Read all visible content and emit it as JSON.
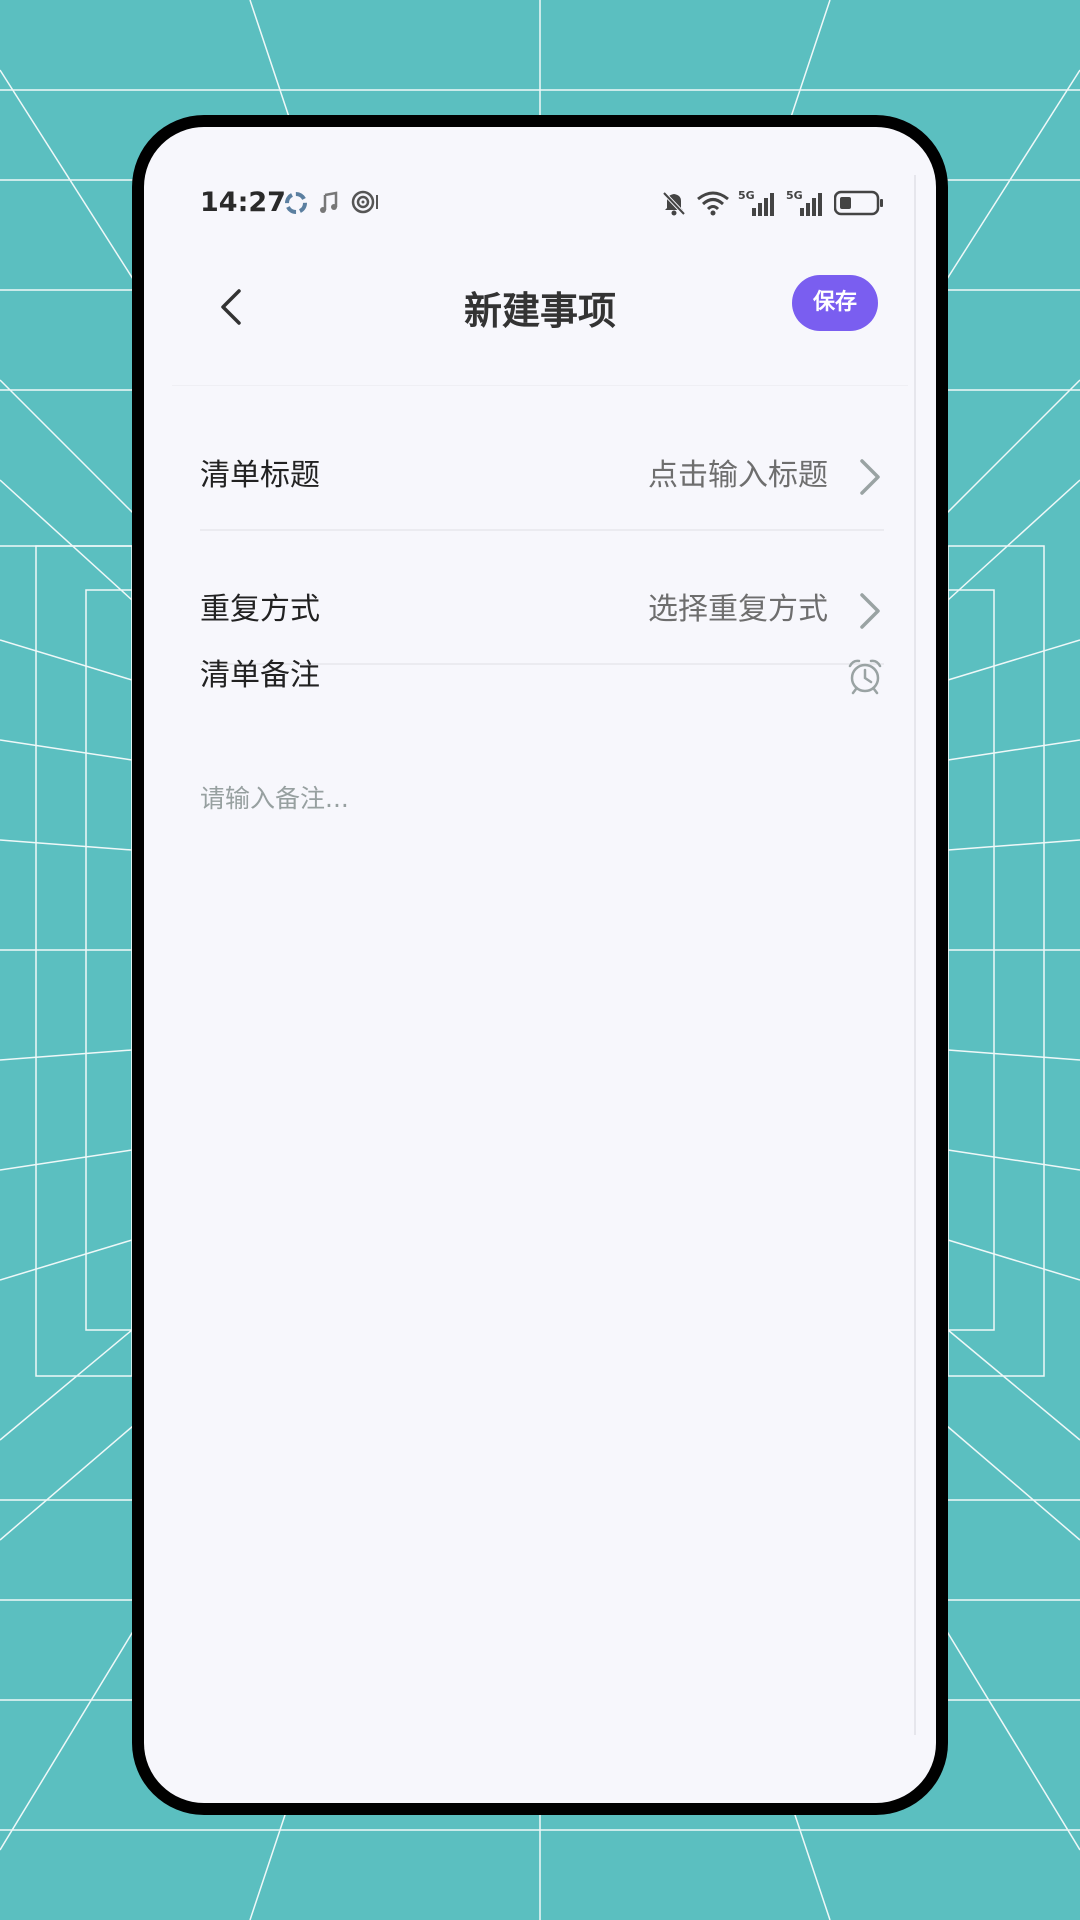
{
  "status_bar": {
    "time": "14:27",
    "network_label": "5G"
  },
  "header": {
    "title": "新建事项",
    "save_label": "保存"
  },
  "form": {
    "title_row": {
      "label": "清单标题",
      "placeholder": "点击输入标题"
    },
    "repeat_row": {
      "label": "重复方式",
      "placeholder": "选择重复方式"
    },
    "notes": {
      "label": "清单备注",
      "placeholder": "请输入备注..."
    }
  },
  "colors": {
    "accent": "#7a5ef0",
    "background": "#5bbfc0",
    "screen": "#f7f7fc"
  },
  "icons": {
    "back": "chevron-left-icon",
    "chevron": "chevron-right-icon",
    "alarm": "alarm-clock-icon",
    "mute": "bell-off-icon",
    "wifi": "wifi-icon",
    "signal": "signal-icon",
    "battery": "battery-icon"
  }
}
